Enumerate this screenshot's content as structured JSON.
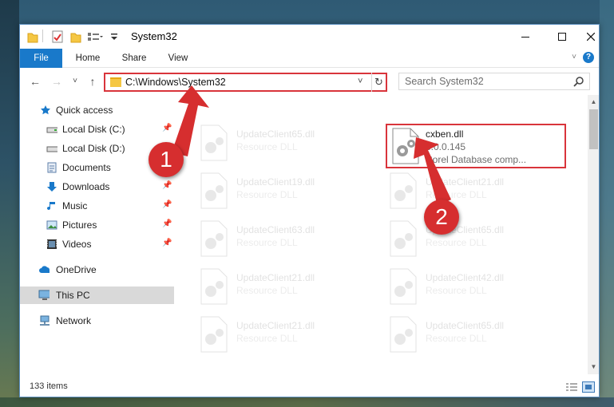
{
  "window": {
    "title": "System32",
    "controls": {
      "minimize": "—",
      "maximize": "☐",
      "close": "✕"
    }
  },
  "ribbon": {
    "tabs": [
      "File",
      "Home",
      "Share",
      "View"
    ],
    "help": "?",
    "collapse_caret": "˅"
  },
  "navbar": {
    "back": "←",
    "forward": "→",
    "recent": "˅",
    "up": "↑",
    "address": "C:\\Windows\\System32",
    "address_caret": "˅",
    "refresh": "↻",
    "search_placeholder": "Search System32"
  },
  "sidebar": {
    "items": [
      {
        "label": "Quick access",
        "icon": "star-icon",
        "pinned": false
      },
      {
        "label": "Local Disk (C:)",
        "icon": "drive-icon",
        "pinned": true
      },
      {
        "label": "Local Disk (D:)",
        "icon": "drive-icon",
        "pinned": false
      },
      {
        "label": "Documents",
        "icon": "documents-icon",
        "pinned": true
      },
      {
        "label": "Downloads",
        "icon": "download-icon",
        "pinned": true
      },
      {
        "label": "Music",
        "icon": "music-icon",
        "pinned": true
      },
      {
        "label": "Pictures",
        "icon": "pictures-icon",
        "pinned": true
      },
      {
        "label": "Videos",
        "icon": "videos-icon",
        "pinned": true
      },
      {
        "label": "OneDrive",
        "icon": "onedrive-icon",
        "pinned": false
      },
      {
        "label": "This PC",
        "icon": "computer-icon",
        "pinned": false,
        "selected": true
      },
      {
        "label": "Network",
        "icon": "network-icon",
        "pinned": false
      }
    ],
    "pin_glyph": "📌"
  },
  "files": {
    "highlighted": {
      "name": "cxben.dll",
      "version": "8.0.0.145",
      "description": "Corel Database comp..."
    },
    "background": [
      {
        "name": "UpdateClient65.dll",
        "type": "Resource DLL"
      },
      {
        "name": "UpdateClient19.dll",
        "type": "Resource DLL"
      },
      {
        "name": "UpdateClient21.dll",
        "type": "Resource DLL"
      },
      {
        "name": "UpdateClient63.dll",
        "type": "Resource DLL"
      },
      {
        "name": "UpdateClient65.dll",
        "type": "Resource DLL"
      },
      {
        "name": "UpdateClient21.dll",
        "type": "Resource DLL"
      },
      {
        "name": "UpdateClient42.dll",
        "type": "Resource DLL"
      },
      {
        "name": "UpdateClient21.dll",
        "type": "Resource DLL"
      },
      {
        "name": "UpdateClient65.dll",
        "type": "Resource DLL"
      }
    ]
  },
  "status": {
    "item_count": "133 items"
  },
  "annotations": {
    "one": "1",
    "two": "2",
    "color": "#d62e2f"
  }
}
